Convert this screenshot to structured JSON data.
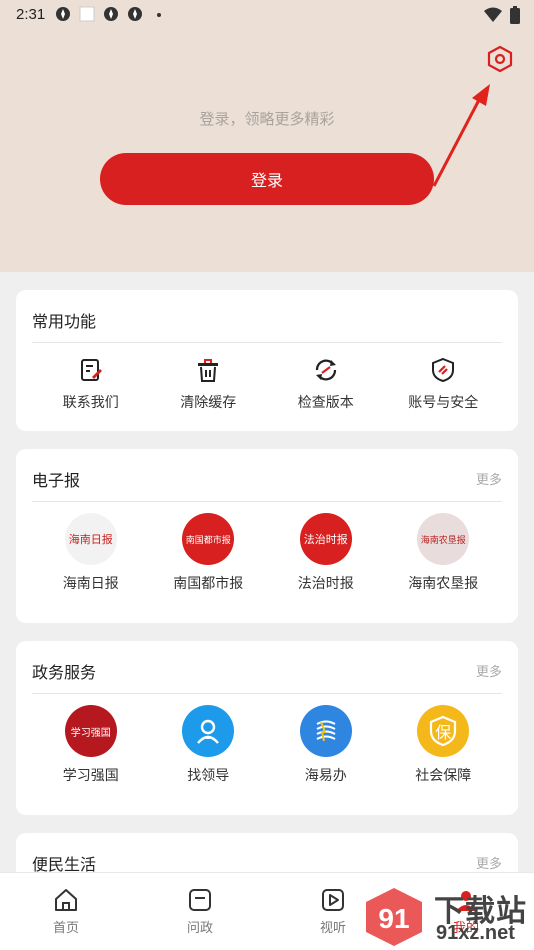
{
  "status_bar": {
    "time": "2:31"
  },
  "header": {
    "login_hint": "登录，领略更多精彩",
    "login_button": "登录"
  },
  "common": {
    "title": "常用功能",
    "items": [
      {
        "label": "联系我们",
        "icon": "contact-edit-icon"
      },
      {
        "label": "清除缓存",
        "icon": "trash-icon"
      },
      {
        "label": "检查版本",
        "icon": "refresh-icon"
      },
      {
        "label": "账号与安全",
        "icon": "shield-icon"
      }
    ]
  },
  "epaper": {
    "title": "电子报",
    "more": "更多",
    "items": [
      {
        "label": "海南日报",
        "logo_text": "海南日报",
        "bg": "#f2f2f2",
        "fg": "#c8201d"
      },
      {
        "label": "南国都市报",
        "logo_text": "南国都市报",
        "bg": "#d7201f",
        "fg": "#ffffff"
      },
      {
        "label": "法治时报",
        "logo_text": "法治时报",
        "bg": "#d7201f",
        "fg": "#ffffff"
      },
      {
        "label": "海南农垦报",
        "logo_text": "海南农垦报",
        "bg": "#e9dcdc",
        "fg": "#b8201d"
      }
    ]
  },
  "gov": {
    "title": "政务服务",
    "more": "更多",
    "items": [
      {
        "label": "学习强国",
        "logo_text": "学习强国",
        "bg": "#b5181e",
        "fg": "#ffffff"
      },
      {
        "label": "找领导",
        "logo_text": "",
        "bg": "#1d9bea",
        "fg": "#ffffff"
      },
      {
        "label": "海易办",
        "logo_text": "",
        "bg": "#2f86e0",
        "fg": "#ffffff"
      },
      {
        "label": "社会保障",
        "logo_text": "保",
        "bg": "#f5b81a",
        "fg": "#ffffff"
      }
    ]
  },
  "life": {
    "title": "便民生活",
    "more": "更多"
  },
  "tabbar": {
    "tabs": [
      {
        "label": "首页"
      },
      {
        "label": "问政"
      },
      {
        "label": "视听"
      },
      {
        "label": "我的"
      }
    ]
  },
  "watermark": {
    "line1": "下载站",
    "line2": "91xz.net",
    "logo": "91"
  },
  "colors": {
    "accent": "#d7201f",
    "header_bg": "#ecdfd6",
    "page_bg": "#efefef"
  }
}
